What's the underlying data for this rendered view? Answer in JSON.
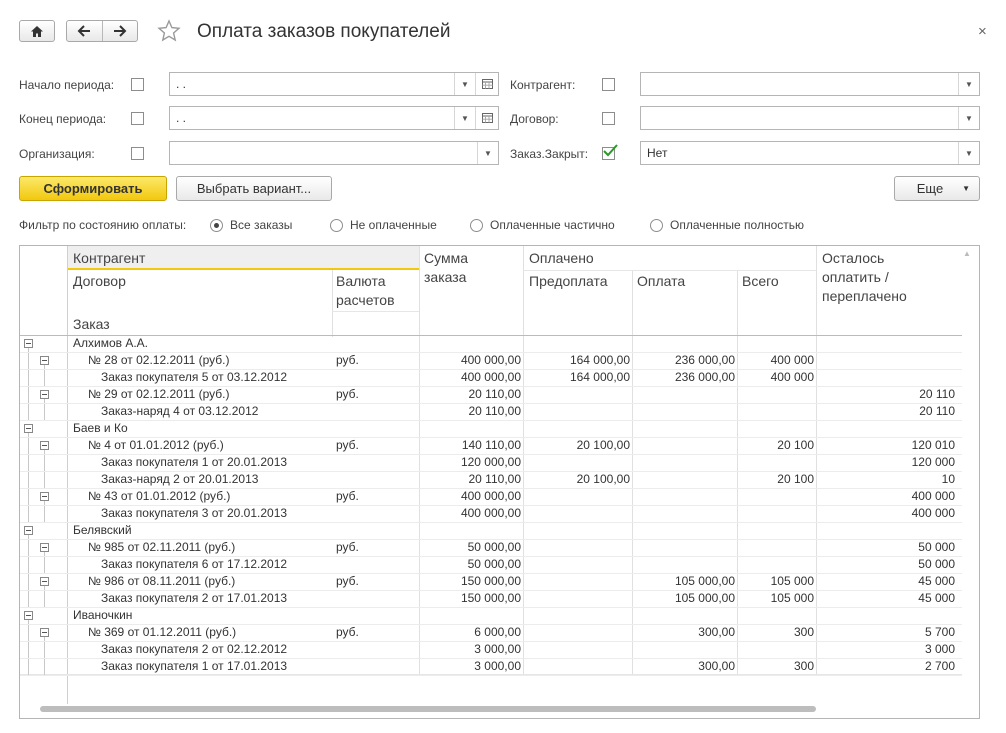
{
  "window": {
    "title": "Оплата заказов покупателей",
    "home_icon": "home-icon",
    "back_icon": "arrow-left-icon",
    "forward_icon": "arrow-right-icon",
    "favorite_icon": "star-icon",
    "close_icon": "close-icon"
  },
  "filters": {
    "period_start": {
      "label": "Начало периода:",
      "value": " .  ."
    },
    "period_end": {
      "label": "Конец периода:",
      "value": " .  ."
    },
    "organization": {
      "label": "Организация:",
      "value": ""
    },
    "counterparty": {
      "label": "Контрагент:",
      "value": ""
    },
    "contract": {
      "label": "Договор:",
      "value": ""
    },
    "order_closed": {
      "label": "Заказ.Закрыт:",
      "value": "Нет",
      "checked": true
    }
  },
  "toolbar": {
    "generate": "Сформировать",
    "choose_variant": "Выбрать вариант...",
    "more": "Еще"
  },
  "payment_filter": {
    "label": "Фильтр по состоянию оплаты:",
    "options": [
      "Все заказы",
      "Не оплаченные",
      "Оплаченные частично",
      "Оплаченные полностью"
    ],
    "selected": 0
  },
  "report": {
    "headers": {
      "counterparty": "Контрагент",
      "contract": "Договор",
      "currency_1": "Валюта",
      "currency_2": "расчетов",
      "order": "Заказ",
      "order_sum_1": "Сумма",
      "order_sum_2": "заказа",
      "paid": "Оплачено",
      "prepayment": "Предоплата",
      "payment": "Оплата",
      "total": "Всего",
      "remaining_1": "Осталось",
      "remaining_2": "оплатить /",
      "remaining_3": "переплачено"
    },
    "rows": [
      {
        "level": 0,
        "name": "Алхимов А.А.",
        "currency": "",
        "sum": "",
        "prepay": "",
        "pay": "",
        "total": "",
        "rest": ""
      },
      {
        "level": 1,
        "name": "№ 28 от 02.12.2011 (руб.)",
        "currency": "руб.",
        "sum": "400 000,00",
        "prepay": "164 000,00",
        "pay": "236 000,00",
        "total": "400 000",
        "rest": ""
      },
      {
        "level": 2,
        "name": "Заказ покупателя 5 от 03.12.2012",
        "currency": "",
        "sum": "400 000,00",
        "prepay": "164 000,00",
        "pay": "236 000,00",
        "total": "400 000",
        "rest": ""
      },
      {
        "level": 1,
        "name": "№ 29 от 02.12.2011 (руб.)",
        "currency": "руб.",
        "sum": "20 110,00",
        "prepay": "",
        "pay": "",
        "total": "",
        "rest": "20 110"
      },
      {
        "level": 2,
        "name": "Заказ-наряд 4 от 03.12.2012",
        "currency": "",
        "sum": "20 110,00",
        "prepay": "",
        "pay": "",
        "total": "",
        "rest": "20 110"
      },
      {
        "level": 0,
        "name": "Баев и Ко",
        "currency": "",
        "sum": "",
        "prepay": "",
        "pay": "",
        "total": "",
        "rest": ""
      },
      {
        "level": 1,
        "name": "№ 4 от 01.01.2012 (руб.)",
        "currency": "руб.",
        "sum": "140 110,00",
        "prepay": "20 100,00",
        "pay": "",
        "total": "20 100",
        "rest": "120 010"
      },
      {
        "level": 2,
        "name": "Заказ покупателя 1 от 20.01.2013",
        "currency": "",
        "sum": "120 000,00",
        "prepay": "",
        "pay": "",
        "total": "",
        "rest": "120 000"
      },
      {
        "level": 2,
        "name": "Заказ-наряд 2 от 20.01.2013",
        "currency": "",
        "sum": "20 110,00",
        "prepay": "20 100,00",
        "pay": "",
        "total": "20 100",
        "rest": "10"
      },
      {
        "level": 1,
        "name": "№ 43 от 01.01.2012 (руб.)",
        "currency": "руб.",
        "sum": "400 000,00",
        "prepay": "",
        "pay": "",
        "total": "",
        "rest": "400 000"
      },
      {
        "level": 2,
        "name": "Заказ покупателя 3 от 20.01.2013",
        "currency": "",
        "sum": "400 000,00",
        "prepay": "",
        "pay": "",
        "total": "",
        "rest": "400 000"
      },
      {
        "level": 0,
        "name": "Белявский",
        "currency": "",
        "sum": "",
        "prepay": "",
        "pay": "",
        "total": "",
        "rest": ""
      },
      {
        "level": 1,
        "name": "№ 985 от 02.11.2011 (руб.)",
        "currency": "руб.",
        "sum": "50 000,00",
        "prepay": "",
        "pay": "",
        "total": "",
        "rest": "50 000"
      },
      {
        "level": 2,
        "name": "Заказ покупателя 6 от 17.12.2012",
        "currency": "",
        "sum": "50 000,00",
        "prepay": "",
        "pay": "",
        "total": "",
        "rest": "50 000"
      },
      {
        "level": 1,
        "name": "№ 986 от 08.11.2011 (руб.)",
        "currency": "руб.",
        "sum": "150 000,00",
        "prepay": "",
        "pay": "105 000,00",
        "total": "105 000",
        "rest": "45 000"
      },
      {
        "level": 2,
        "name": "Заказ покупателя 2 от 17.01.2013",
        "currency": "",
        "sum": "150 000,00",
        "prepay": "",
        "pay": "105 000,00",
        "total": "105 000",
        "rest": "45 000"
      },
      {
        "level": 0,
        "name": "Иваночкин",
        "currency": "",
        "sum": "",
        "prepay": "",
        "pay": "",
        "total": "",
        "rest": ""
      },
      {
        "level": 1,
        "name": "№ 369 от 01.12.2011 (руб.)",
        "currency": "руб.",
        "sum": "6 000,00",
        "prepay": "",
        "pay": "300,00",
        "total": "300",
        "rest": "5 700"
      },
      {
        "level": 2,
        "name": "Заказ покупателя 2 от 02.12.2012",
        "currency": "",
        "sum": "3 000,00",
        "prepay": "",
        "pay": "",
        "total": "",
        "rest": "3 000"
      },
      {
        "level": 2,
        "name": "Заказ покупателя 1 от 17.01.2013",
        "currency": "",
        "sum": "3 000,00",
        "prepay": "",
        "pay": "300,00",
        "total": "300",
        "rest": "2 700"
      }
    ]
  }
}
